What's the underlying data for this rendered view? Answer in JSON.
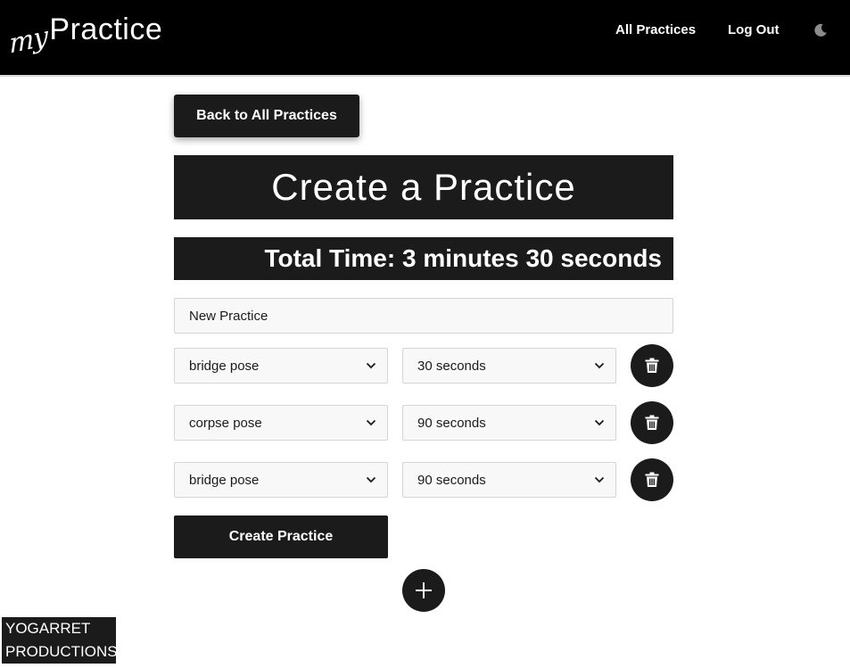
{
  "brand": {
    "prefix": "my",
    "name": "Practice"
  },
  "nav": {
    "all_practices": "All Practices",
    "log_out": "Log Out",
    "theme_icon": "moon-icon"
  },
  "back_button": "Back to All Practices",
  "page_title": "Create a Practice",
  "total_time": "Total Time: 3 minutes 30 seconds",
  "practice_name": {
    "value": "New Practice"
  },
  "rows": [
    {
      "pose": "bridge pose",
      "duration": "30 seconds"
    },
    {
      "pose": "corpse pose",
      "duration": "90 seconds"
    },
    {
      "pose": "bridge pose",
      "duration": "90 seconds"
    }
  ],
  "create_button": "Create Practice",
  "footer": {
    "line1": "YOGARRET",
    "line2": "PRODUCTIONS"
  },
  "colors": {
    "navbar": "#000000",
    "button": "#1b1b1b",
    "input_bg": "#f9f8f8",
    "text_light": "#ffffff"
  },
  "icons": {
    "delete": "trash-icon",
    "add": "plus-icon",
    "dropdown": "chevron-down-icon"
  }
}
